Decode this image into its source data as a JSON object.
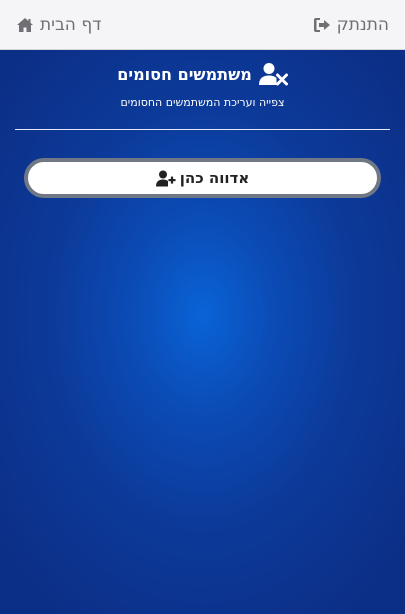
{
  "header": {
    "home_label": "דף הבית",
    "home_icon": "home-icon",
    "logout_label": "התנתק",
    "logout_icon": "logout-icon"
  },
  "main": {
    "title": "משתמשים חסומים",
    "title_icon": "user-blocked-icon",
    "subtitle": "צפייה ועריכת המשתמשים החסומים",
    "add_button_label": "אדווה כהן",
    "add_button_icon": "user-plus-icon"
  },
  "colors": {
    "background_dark": "#0c2f86",
    "background_light": "#0a63d6",
    "topbar": "#f5f5f7",
    "topbar_text": "#707074"
  }
}
